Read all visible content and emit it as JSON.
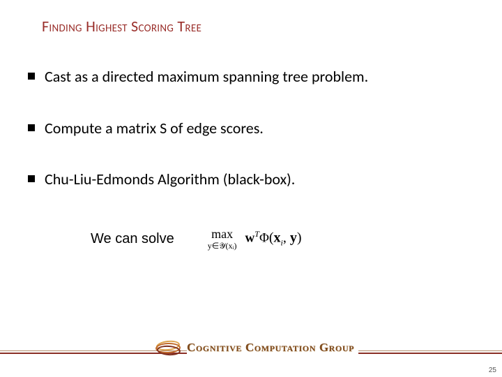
{
  "title": "Finding Highest Scoring Tree",
  "bullets": [
    "Cast as a directed maximum spanning tree problem.",
    "Compute a matrix S of edge scores.",
    "Chu-Liu-Edmonds Algorithm (black-box)."
  ],
  "solve_text": "We can solve",
  "formula": {
    "max_top": "max",
    "max_bottom": "y∈𝒴(xᵢ)",
    "w": "w",
    "w_sup": "T",
    "phi": "Φ",
    "args_open": "(",
    "x": "x",
    "x_sub": "i",
    "comma": ", ",
    "y": "y",
    "args_close": ")"
  },
  "brand": "Cognitive Computation Group",
  "page_number": "25"
}
